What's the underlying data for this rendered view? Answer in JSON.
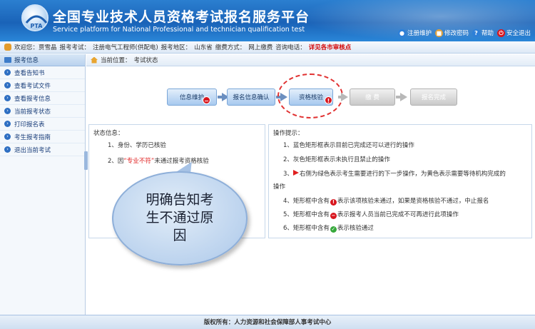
{
  "header": {
    "title_cn": "全国专业技术人员资格考试报名服务平台",
    "title_en": "Service platform for National Professional and technician qualification test",
    "logo_text": "PTA",
    "links": [
      {
        "label": "注册维护",
        "icon": "register-icon",
        "color": "#2d7fd8"
      },
      {
        "label": "修改密码",
        "icon": "lock-icon",
        "color": "#e0a03a"
      },
      {
        "label": "帮助",
        "icon": "help-icon",
        "color": "#2d7fd8"
      },
      {
        "label": "安全退出",
        "icon": "power-icon",
        "color": "#d8161e"
      }
    ]
  },
  "infobar": {
    "welcome": "欢迎您：贾雪晶",
    "exam_label": "报考考试：",
    "exam_value": "注册电气工程师(供配电)",
    "region_label": "报考地区：",
    "region_value": "山东省",
    "pay_label": "缴费方式：",
    "pay_value": "网上缴费",
    "phone_label": "咨询电话：",
    "phone_value": "详见各市审核点"
  },
  "sidebar": {
    "heading": "报考信息",
    "items": [
      {
        "label": "查看告知书"
      },
      {
        "label": "查看考试文件"
      },
      {
        "label": "查看报考信息"
      },
      {
        "label": "当前报考状态"
      },
      {
        "label": "打印报名表"
      },
      {
        "label": "考生报考指南"
      },
      {
        "label": "退出当前考试"
      }
    ]
  },
  "breadcrumb": {
    "label": "当前位置：",
    "value": "考试状态"
  },
  "steps": [
    {
      "label": "信息维护",
      "state": "blue",
      "badge": "−"
    },
    {
      "label": "报名信息确认",
      "state": "blue",
      "badge": ""
    },
    {
      "label": "资格核验",
      "state": "blue",
      "badge": "!"
    },
    {
      "label": "缴 费",
      "state": "gray",
      "badge": ""
    },
    {
      "label": "报名完成",
      "state": "gray",
      "badge": ""
    }
  ],
  "status_panel": {
    "title": "状态信息：",
    "line1": "1、身份、学历已核验",
    "line2_prefix": "2、因",
    "line2_highlight": "“专业不符”",
    "line2_suffix": "未通过报考资格核验"
  },
  "ops_panel": {
    "title": "操作提示：",
    "line1": "1、蓝色矩形框表示目前已完成还可以进行的操作",
    "line2": "2、灰色矩形框表示未执行且禁止的操作",
    "line3a": "3、",
    "line3b": "右侧为绿色表示考生需要进行的下一步操作，为黄色表示需要等待机构完成的",
    "line3c": "操作",
    "line4a": "4、矩形框中含有",
    "line4b": "表示该项核验未通过，如果是资格核验不通过，中止报名",
    "line5a": "5、矩形框中含有",
    "line5b": "表示报考人员当前已完成不可再进行此项操作",
    "line6a": "6、矩形框中含有",
    "line6b": "表示核验通过"
  },
  "callout": {
    "line1": "明确告知考",
    "line2": "生不通过原",
    "line3": "因"
  },
  "footer": {
    "text": "版权所有：人力资源和社会保障部人事考试中心"
  }
}
